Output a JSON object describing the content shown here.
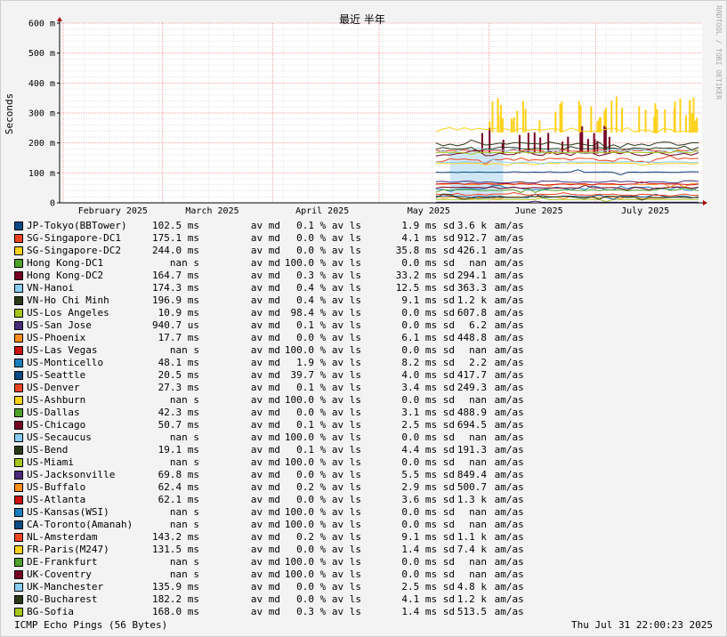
{
  "chart_data": {
    "type": "line",
    "title": "最近 半年",
    "ylabel": "Seconds",
    "watermark": "RRDTOOL / TOBI OETIKER",
    "x_ticks": [
      "February 2025",
      "March 2025",
      "April 2025",
      "May 2025",
      "June 2025",
      "July 2025"
    ],
    "y_ticks": [
      "0",
      "100 m",
      "200 m",
      "300 m",
      "400 m",
      "500 m",
      "600 m"
    ],
    "ylim": [
      0,
      0.6
    ],
    "x_range": [
      "2025-01-31",
      "2025-07-31"
    ],
    "data_start": "2025-05-17",
    "grid": true,
    "series": [
      {
        "name": "JP-Tokyo(BBTower)",
        "color": "#0a4a86",
        "avg": "102.5",
        "avg_unit": "ms",
        "loss": "0.1",
        "sd": "1.9",
        "sd_unit": "ms",
        "amas": "3.6 k"
      },
      {
        "name": "SG-Singapore-DC1",
        "color": "#ee4422",
        "avg": "175.1",
        "avg_unit": "ms",
        "loss": "0.0",
        "sd": "4.1",
        "sd_unit": "ms",
        "amas": "912.7"
      },
      {
        "name": "SG-Singapore-DC2",
        "color": "#ffd21a",
        "avg": "244.0",
        "avg_unit": "ms",
        "loss": "0.0",
        "sd": "35.8",
        "sd_unit": "ms",
        "amas": "426.1"
      },
      {
        "name": "Hong Kong-DC1",
        "color": "#4fa32a",
        "avg": "nan",
        "avg_unit": "s",
        "loss": "100.0",
        "sd": "0.0",
        "sd_unit": "ms",
        "amas": "nan"
      },
      {
        "name": "Hong Kong-DC2",
        "color": "#770022",
        "avg": "164.7",
        "avg_unit": "ms",
        "loss": "0.3",
        "sd": "33.2",
        "sd_unit": "ms",
        "amas": "294.1"
      },
      {
        "name": "VN-Hanoi",
        "color": "#88ccf2",
        "avg": "174.3",
        "avg_unit": "ms",
        "loss": "0.4",
        "sd": "12.5",
        "sd_unit": "ms",
        "amas": "363.3"
      },
      {
        "name": "VN-Ho Chi Minh",
        "color": "#2a3a1a",
        "avg": "196.9",
        "avg_unit": "ms",
        "loss": "0.4",
        "sd": "9.1",
        "sd_unit": "ms",
        "amas": "1.2 k"
      },
      {
        "name": "US-Los Angeles",
        "color": "#a6c61a",
        "avg": "10.9",
        "avg_unit": "ms",
        "loss": "98.4",
        "sd": "0.0",
        "sd_unit": "ms",
        "amas": "607.8"
      },
      {
        "name": "US-San Jose",
        "color": "#4a2a7a",
        "avg": "940.7",
        "avg_unit": "us",
        "loss": "0.1",
        "sd": "0.0",
        "sd_unit": "ms",
        "amas": "6.2"
      },
      {
        "name": "US-Phoenix",
        "color": "#ff8f1a",
        "avg": "17.7",
        "avg_unit": "ms",
        "loss": "0.0",
        "sd": "6.1",
        "sd_unit": "ms",
        "amas": "448.8"
      },
      {
        "name": "US-Las Vegas",
        "color": "#cc1111",
        "avg": "nan",
        "avg_unit": "s",
        "loss": "100.0",
        "sd": "0.0",
        "sd_unit": "ms",
        "amas": "nan"
      },
      {
        "name": "US-Monticello",
        "color": "#1a7fbf",
        "avg": "48.1",
        "avg_unit": "ms",
        "loss": "1.9",
        "sd": "8.2",
        "sd_unit": "ms",
        "amas": "2.2"
      },
      {
        "name": "US-Seattle",
        "color": "#0a4a86",
        "avg": "20.5",
        "avg_unit": "ms",
        "loss": "39.7",
        "sd": "4.0",
        "sd_unit": "ms",
        "amas": "417.7"
      },
      {
        "name": "US-Denver",
        "color": "#ee4422",
        "avg": "27.3",
        "avg_unit": "ms",
        "loss": "0.1",
        "sd": "3.4",
        "sd_unit": "ms",
        "amas": "249.3"
      },
      {
        "name": "US-Ashburn",
        "color": "#ffd21a",
        "avg": "nan",
        "avg_unit": "s",
        "loss": "100.0",
        "sd": "0.0",
        "sd_unit": "ms",
        "amas": "nan"
      },
      {
        "name": "US-Dallas",
        "color": "#4fa32a",
        "avg": "42.3",
        "avg_unit": "ms",
        "loss": "0.0",
        "sd": "3.1",
        "sd_unit": "ms",
        "amas": "488.9"
      },
      {
        "name": "US-Chicago",
        "color": "#770022",
        "avg": "50.7",
        "avg_unit": "ms",
        "loss": "0.1",
        "sd": "2.5",
        "sd_unit": "ms",
        "amas": "694.5"
      },
      {
        "name": "US-Secaucus",
        "color": "#88ccf2",
        "avg": "nan",
        "avg_unit": "s",
        "loss": "100.0",
        "sd": "0.0",
        "sd_unit": "ms",
        "amas": "nan"
      },
      {
        "name": "US-Bend",
        "color": "#2a3a1a",
        "avg": "19.1",
        "avg_unit": "ms",
        "loss": "0.1",
        "sd": "4.4",
        "sd_unit": "ms",
        "amas": "191.3"
      },
      {
        "name": "US-Miami",
        "color": "#a6c61a",
        "avg": "nan",
        "avg_unit": "s",
        "loss": "100.0",
        "sd": "0.0",
        "sd_unit": "ms",
        "amas": "nan"
      },
      {
        "name": "US-Jacksonville",
        "color": "#4a2a7a",
        "avg": "69.8",
        "avg_unit": "ms",
        "loss": "0.0",
        "sd": "5.5",
        "sd_unit": "ms",
        "amas": "849.4"
      },
      {
        "name": "US-Buffalo",
        "color": "#ff8f1a",
        "avg": "62.4",
        "avg_unit": "ms",
        "loss": "0.2",
        "sd": "2.9",
        "sd_unit": "ms",
        "amas": "500.7"
      },
      {
        "name": "US-Atlanta",
        "color": "#cc1111",
        "avg": "62.1",
        "avg_unit": "ms",
        "loss": "0.0",
        "sd": "3.6",
        "sd_unit": "ms",
        "amas": "1.3 k"
      },
      {
        "name": "US-Kansas(WSI)",
        "color": "#1a7fbf",
        "avg": "nan",
        "avg_unit": "s",
        "loss": "100.0",
        "sd": "0.0",
        "sd_unit": "ms",
        "amas": "nan"
      },
      {
        "name": "CA-Toronto(Amanah)",
        "color": "#0a4a86",
        "avg": "nan",
        "avg_unit": "s",
        "loss": "100.0",
        "sd": "0.0",
        "sd_unit": "ms",
        "amas": "nan"
      },
      {
        "name": "NL-Amsterdam",
        "color": "#ee4422",
        "avg": "143.2",
        "avg_unit": "ms",
        "loss": "0.2",
        "sd": "9.1",
        "sd_unit": "ms",
        "amas": "1.1 k"
      },
      {
        "name": "FR-Paris(M247)",
        "color": "#ffd21a",
        "avg": "131.5",
        "avg_unit": "ms",
        "loss": "0.0",
        "sd": "1.4",
        "sd_unit": "ms",
        "amas": "7.4 k"
      },
      {
        "name": "DE-Frankfurt",
        "color": "#4fa32a",
        "avg": "nan",
        "avg_unit": "s",
        "loss": "100.0",
        "sd": "0.0",
        "sd_unit": "ms",
        "amas": "nan"
      },
      {
        "name": "UK-Coventry",
        "color": "#770022",
        "avg": "nan",
        "avg_unit": "s",
        "loss": "100.0",
        "sd": "0.0",
        "sd_unit": "ms",
        "amas": "nan"
      },
      {
        "name": "UK-Manchester",
        "color": "#88ccf2",
        "avg": "135.9",
        "avg_unit": "ms",
        "loss": "0.0",
        "sd": "2.5",
        "sd_unit": "ms",
        "amas": "4.8 k"
      },
      {
        "name": "RO-Bucharest",
        "color": "#2a3a1a",
        "avg": "182.2",
        "avg_unit": "ms",
        "loss": "0.0",
        "sd": "4.1",
        "sd_unit": "ms",
        "amas": "1.2 k"
      },
      {
        "name": "BG-Sofia",
        "color": "#a6c61a",
        "avg": "168.0",
        "avg_unit": "ms",
        "loss": "0.3",
        "sd": "1.4",
        "sd_unit": "ms",
        "amas": "513.5"
      }
    ]
  },
  "labels": {
    "av_md": "av md",
    "pct_av_ls": "% av ls",
    "sd": "sd",
    "amas": "am/as"
  },
  "footer": {
    "left": "ICMP Echo Pings (56 Bytes)",
    "right": "Thu Jul 31 22:00:23 2025"
  }
}
